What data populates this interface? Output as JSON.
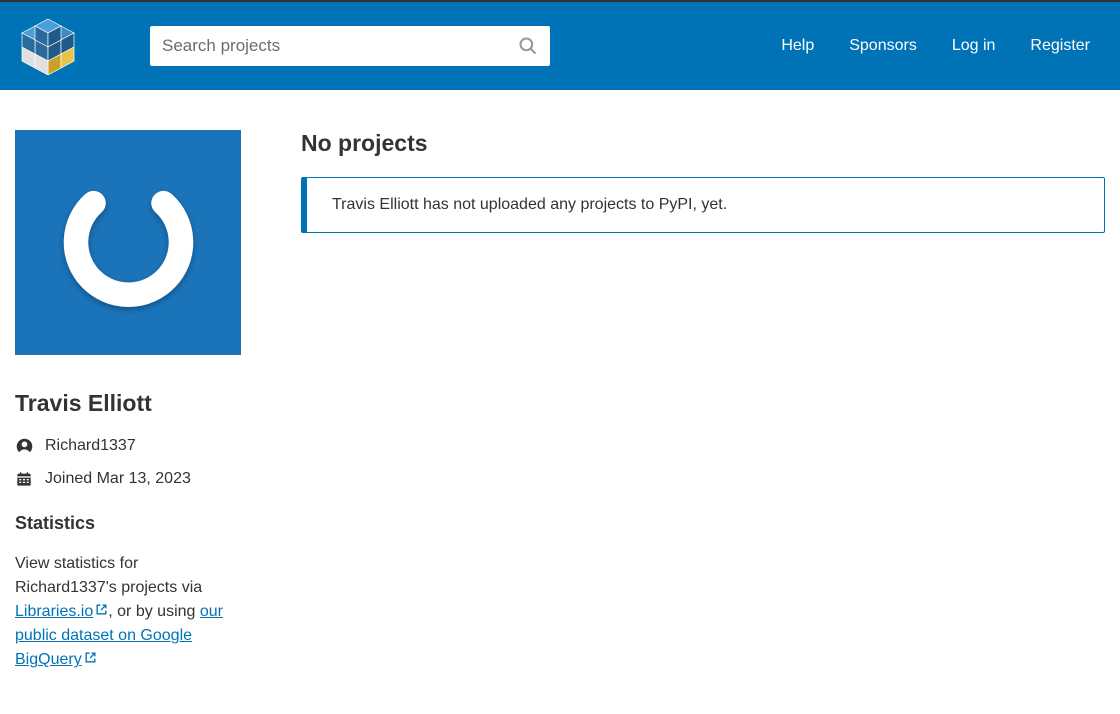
{
  "search": {
    "placeholder": "Search projects"
  },
  "nav": {
    "help": "Help",
    "sponsors": "Sponsors",
    "login": "Log in",
    "register": "Register"
  },
  "profile": {
    "name": "Travis Elliott",
    "username": "Richard1337",
    "joined": "Joined Mar 13, 2023"
  },
  "statistics": {
    "heading": "Statistics",
    "text_prefix": "View statistics for Richard1337's projects via ",
    "libraries_link": "Libraries.io",
    "text_middle": ", or by using ",
    "bigquery_link": "our public dataset on Google BigQuery"
  },
  "content": {
    "heading": "No projects",
    "alert": "Travis Elliott has not uploaded any projects to PyPI, yet."
  }
}
